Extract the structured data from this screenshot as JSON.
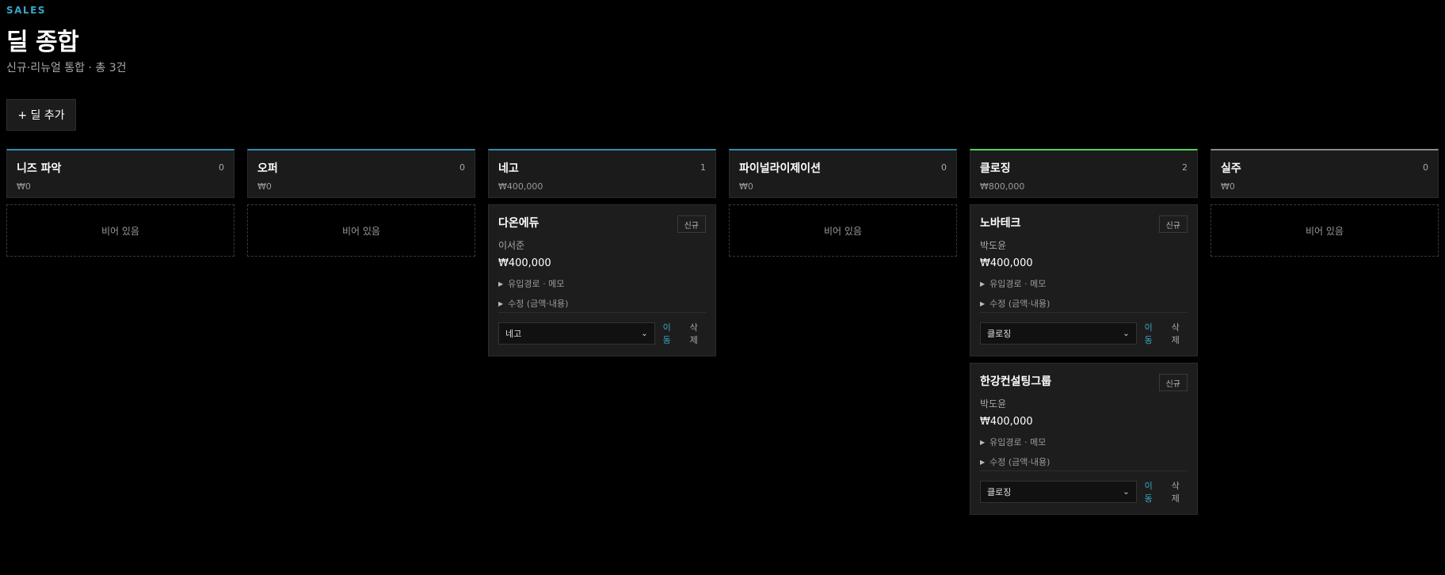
{
  "header": {
    "eyebrow": "SALES",
    "title": "딜 종합",
    "subtitle": "신규·리뉴얼 통합 · 총 3건"
  },
  "toolbar": {
    "add_label": "+ 딜 추가"
  },
  "empty_label": "비어 있음",
  "columns": [
    {
      "name": "니즈 파악",
      "count": "0",
      "total": "₩0"
    },
    {
      "name": "오퍼",
      "count": "0",
      "total": "₩0"
    },
    {
      "name": "네고",
      "count": "1",
      "total": "₩400,000"
    },
    {
      "name": "파이널라이제이션",
      "count": "0",
      "total": "₩0"
    },
    {
      "name": "클로징",
      "count": "2",
      "total": "₩800,000"
    },
    {
      "name": "실주",
      "count": "0",
      "total": "₩0"
    }
  ],
  "cards": [
    {
      "company": "다온에듀",
      "badge": "신규",
      "owner": "이서준",
      "amount": "₩400,000",
      "details_source": "유입경로 · 메모",
      "details_edit": "수정 (금액·내용)",
      "stage": "네고",
      "move": "이동",
      "delete": "삭제"
    },
    {
      "company": "노바테크",
      "badge": "신규",
      "owner": "박도윤",
      "amount": "₩400,000",
      "details_source": "유입경로 · 메모",
      "details_edit": "수정 (금액·내용)",
      "stage": "클로징",
      "move": "이동",
      "delete": "삭제"
    },
    {
      "company": "한강컨설팅그룹",
      "badge": "신규",
      "owner": "박도윤",
      "amount": "₩400,000",
      "details_source": "유입경로 · 메모",
      "details_edit": "수정 (금액·내용)",
      "stage": "클로징",
      "move": "이동",
      "delete": "삭제"
    }
  ],
  "colors": {
    "accent": "#3aa6c9",
    "closing": "#4fd35a",
    "lost": "#8a8a8a"
  }
}
